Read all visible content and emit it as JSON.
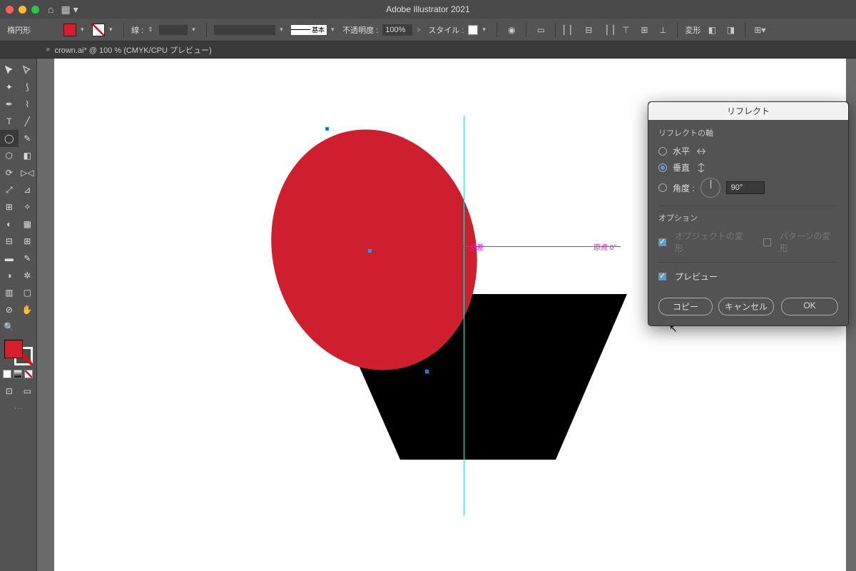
{
  "app": {
    "title": "Adobe Illustrator 2021"
  },
  "propbar": {
    "shape": "楕円形",
    "stroke_label": "線 :",
    "brush_label": "基本",
    "opacity_label": "不透明度 :",
    "opacity_value": "100%",
    "style_label": "スタイル :",
    "transform_label": "変形"
  },
  "tab": {
    "close": "×",
    "name": "crown.ai* @ 100 % (CMYK/CPU プレビュー)"
  },
  "canvas": {
    "intersect_label": "交差",
    "origin_label": "原点 0°"
  },
  "dialog": {
    "title": "リフレクト",
    "axis_section": "リフレクトの軸",
    "horizontal": "水平",
    "vertical": "垂直",
    "angle_label": "角度 :",
    "angle_value": "90°",
    "options_section": "オプション",
    "transform_objects": "オブジェクトの変形",
    "transform_patterns": "パターンの変形",
    "preview": "プレビュー",
    "copy": "コピー",
    "cancel": "キャンセル",
    "ok": "OK"
  }
}
